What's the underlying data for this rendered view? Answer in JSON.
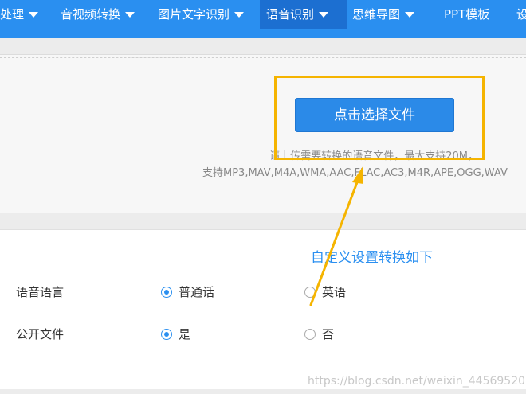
{
  "nav": {
    "items": [
      {
        "label": "文档处理",
        "visible": "处理"
      },
      {
        "label": "音视频转换"
      },
      {
        "label": "图片文字识别"
      },
      {
        "label": "语音识别"
      },
      {
        "label": "思维导图"
      },
      {
        "label": "PPT模板"
      },
      {
        "label": "设"
      }
    ],
    "active_index": 3
  },
  "upload": {
    "button_label": "点击选择文件",
    "hint_line1": "请上传需要转换的语音文件，最大支持20M，",
    "hint_line2": "支持MP3,MAV,M4A,WMA,AAC,FLAC,AC3,M4R,APE,OGG,WAV"
  },
  "settings": {
    "title": "自定义设置转换如下",
    "language": {
      "label": "语音语言",
      "options": [
        "普通话",
        "英语"
      ],
      "selected": "普通话"
    },
    "public_file": {
      "label": "公开文件",
      "options": [
        "是",
        "否"
      ],
      "selected": "是"
    }
  },
  "watermark": "https://blog.csdn.net/weixin_44569520",
  "colors": {
    "nav_bg": "#2a8ff0",
    "nav_active": "#1c6fd1",
    "highlight": "#f5b400",
    "button": "#2b8ae8",
    "accent_text": "#2a8ff0"
  }
}
